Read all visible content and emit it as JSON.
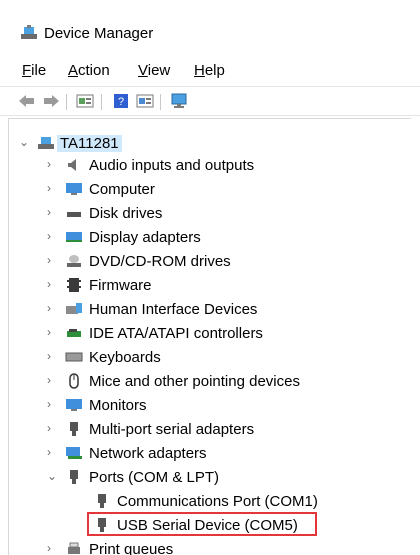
{
  "window": {
    "title": "Device Manager"
  },
  "menu": {
    "file": "ile",
    "file_key": "F",
    "action": "ction",
    "action_key": "A",
    "view": "iew",
    "view_key": "V",
    "help": "elp",
    "help_key": "H"
  },
  "toolbar": {
    "icons": [
      "back-arrow-icon",
      "forward-arrow-icon",
      "properties-icon",
      "help-icon",
      "scan-icon",
      "monitor-icon"
    ]
  },
  "tree": {
    "root": "TA11281",
    "items": [
      {
        "label": "Audio inputs and outputs",
        "icon": "speaker-icon"
      },
      {
        "label": "Computer",
        "icon": "computer-icon"
      },
      {
        "label": "Disk drives",
        "icon": "disk-drive-icon"
      },
      {
        "label": "Display adapters",
        "icon": "display-adapter-icon"
      },
      {
        "label": "DVD/CD-ROM drives",
        "icon": "dvd-drive-icon"
      },
      {
        "label": "Firmware",
        "icon": "firmware-icon"
      },
      {
        "label": "Human Interface Devices",
        "icon": "hid-icon"
      },
      {
        "label": "IDE ATA/ATAPI controllers",
        "icon": "ide-controller-icon"
      },
      {
        "label": "Keyboards",
        "icon": "keyboard-icon"
      },
      {
        "label": "Mice and other pointing devices",
        "icon": "mouse-icon"
      },
      {
        "label": "Monitors",
        "icon": "monitor-icon"
      },
      {
        "label": "Multi-port serial adapters",
        "icon": "serial-adapter-icon"
      },
      {
        "label": "Network adapters",
        "icon": "network-adapter-icon"
      },
      {
        "label": "Ports (COM & LPT)",
        "icon": "port-icon"
      },
      {
        "label": "Communications Port (COM1)",
        "icon": "port-icon"
      },
      {
        "label": "USB Serial Device (COM5)",
        "icon": "port-icon"
      },
      {
        "label": "Print queues",
        "icon": "printer-icon"
      }
    ]
  },
  "colors": {
    "selection": "#cfe8fc",
    "highlight_box": "#e4353a",
    "chevron": "#6b6b6b"
  }
}
